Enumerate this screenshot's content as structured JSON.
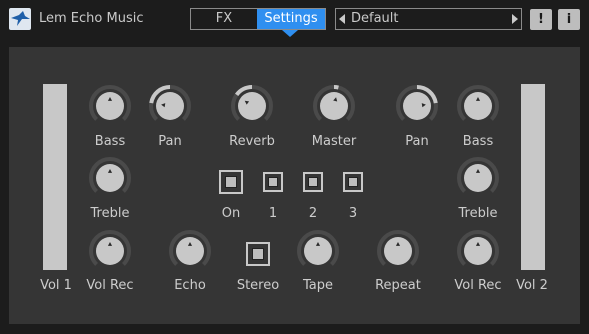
{
  "header": {
    "app_title": "Lem Echo Music",
    "logo": "bird-logo",
    "tabs": [
      {
        "label": "FX",
        "active": false
      },
      {
        "label": "Settings",
        "active": true
      }
    ],
    "preset": {
      "name": "Default"
    },
    "alert_label": "!",
    "info_label": "i"
  },
  "colors": {
    "background": "#1c1c1c",
    "panel": "#353535",
    "accent": "#2f8ff0",
    "control": "#c8c8c8",
    "track": "#4a4a4a"
  },
  "controls": {
    "vol1_label": "Vol 1",
    "vol2_label": "Vol 2",
    "bass_left": {
      "label": "Bass",
      "value": 0.5
    },
    "pan_left": {
      "label": "Pan",
      "value": 0.2
    },
    "reverb": {
      "label": "Reverb",
      "value": 0.3
    },
    "master": {
      "label": "Master",
      "value": 0.55
    },
    "pan_right": {
      "label": "Pan",
      "value": 0.8
    },
    "bass_right": {
      "label": "Bass",
      "value": 0.5
    },
    "treble_left": {
      "label": "Treble",
      "value": 0.5
    },
    "treble_right": {
      "label": "Treble",
      "value": 0.5
    },
    "volrec_left": {
      "label": "Vol Rec",
      "value": 0.5
    },
    "echo": {
      "label": "Echo",
      "value": 0.5
    },
    "tape": {
      "label": "Tape",
      "value": 0.5
    },
    "repeat": {
      "label": "Repeat",
      "value": 0.5
    },
    "volrec_right": {
      "label": "Vol Rec",
      "value": 0.5
    },
    "on_label": "On",
    "stereo_label": "Stereo",
    "buttons": [
      "1",
      "2",
      "3"
    ]
  }
}
